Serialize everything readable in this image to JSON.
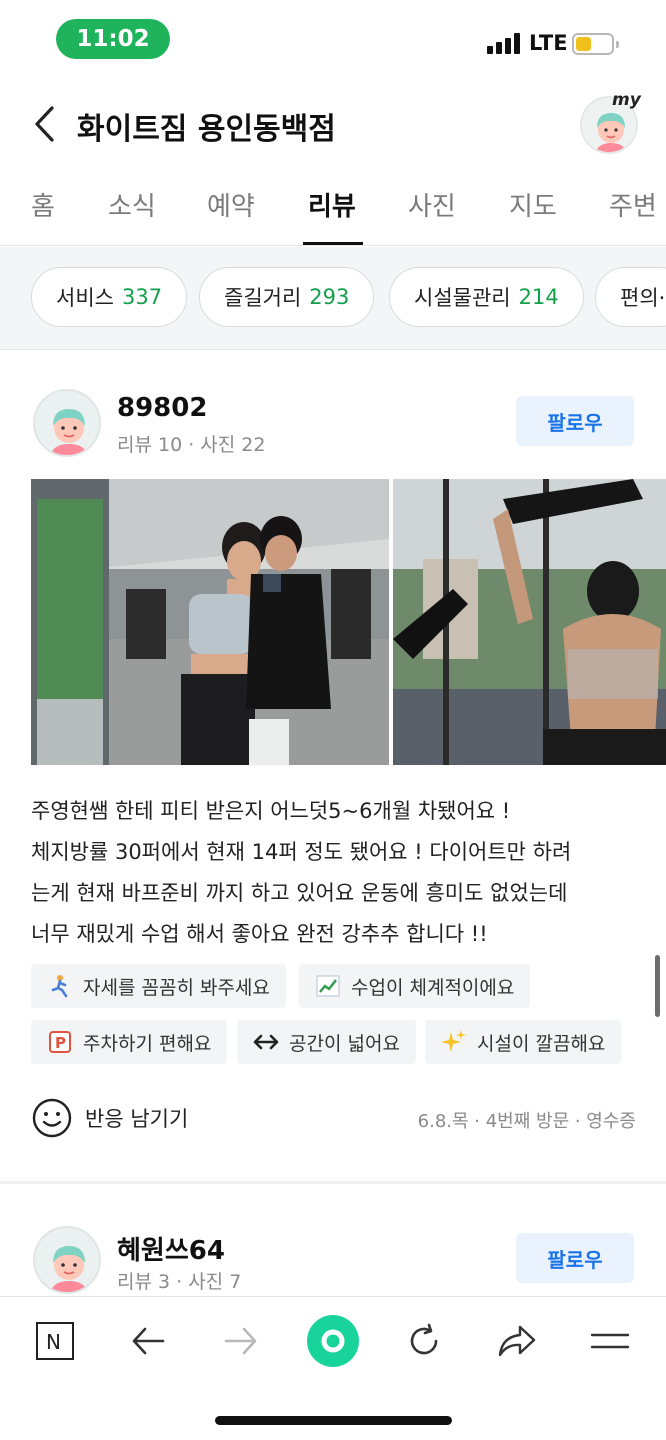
{
  "status_bar": {
    "time": "11:02",
    "network": "LTE"
  },
  "header": {
    "title": "화이트짐 용인동백점",
    "my_badge": "my"
  },
  "tabs": [
    {
      "label": "홈"
    },
    {
      "label": "소식"
    },
    {
      "label": "예약"
    },
    {
      "label": "리뷰",
      "active": true
    },
    {
      "label": "사진"
    },
    {
      "label": "지도"
    },
    {
      "label": "주변"
    }
  ],
  "filters": [
    {
      "label": "서비스",
      "count": "337"
    },
    {
      "label": "즐길거리",
      "count": "293"
    },
    {
      "label": "시설물관리",
      "count": "214"
    },
    {
      "label": "편의·"
    }
  ],
  "reviews": [
    {
      "name": "89802",
      "meta": "리뷰 10 · 사진 22",
      "follow": "팔로우",
      "text": [
        "주영현쌤 한테 피티 받은지 어느덧5~6개월 차됐어요 !",
        "체지방률 30퍼에서 현재 14퍼 정도 됐어요 ! 다이어트만 하려",
        "는게 현재 바프준비 까지 하고 있어요 운동에 흥미도 없었는데",
        "너무 재밌게 수업 해서 좋아요 완전 강추추 합니다 !!"
      ],
      "tags": [
        {
          "icon": "person-exercise-icon",
          "label": "자세를 꼼꼼히 봐주세요"
        },
        {
          "icon": "chart-up-icon",
          "label": "수업이 체계적이에요"
        },
        {
          "icon": "parking-icon",
          "label": "주차하기 편해요"
        },
        {
          "icon": "arrows-horizontal-icon",
          "label": "공간이 넓어요"
        },
        {
          "icon": "sparkles-icon",
          "label": "시설이 깔끔해요"
        }
      ],
      "react_label": "반응 남기기",
      "visit_meta": "6.8.목 · 4번째 방문 · 영수증"
    },
    {
      "name": "혜원쓰64",
      "meta": "리뷰 3 · 사진 7",
      "follow": "팔로우"
    }
  ],
  "bottom_nav": [
    "naver-home-icon",
    "back-arrow-icon",
    "forward-arrow-icon",
    "green-dot-icon",
    "refresh-icon",
    "share-icon",
    "menu-icon"
  ],
  "colors": {
    "accent_green": "#12a14a",
    "follow_blue": "#1a73e8",
    "status_green": "#1fb45b"
  }
}
